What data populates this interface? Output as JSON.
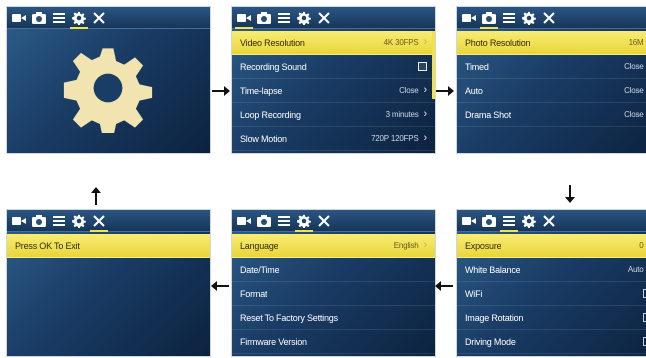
{
  "screens": {
    "s1": {
      "tabs": [
        "video-icon",
        "camera-icon",
        "menu-icon",
        "gear-icon",
        "close-icon"
      ],
      "active_tab": "gear-icon"
    },
    "s2": {
      "rows": [
        {
          "label": "Video Resolution",
          "value": "4K 30FPS",
          "control": "chevron",
          "selected": true
        },
        {
          "label": "Recording Sound",
          "value": "",
          "control": "checkbox-checked",
          "selected": false
        },
        {
          "label": "Time-lapse",
          "value": "Close",
          "control": "chevron",
          "selected": false
        },
        {
          "label": "Loop Recording",
          "value": "3 minutes",
          "control": "chevron",
          "selected": false
        },
        {
          "label": "Slow Motion",
          "value": "720P 120FPS",
          "control": "chevron",
          "selected": false
        }
      ]
    },
    "s3": {
      "rows": [
        {
          "label": "Photo Resolution",
          "value": "16M",
          "control": "chevron",
          "selected": true
        },
        {
          "label": "Timed",
          "value": "Close",
          "control": "chevron",
          "selected": false
        },
        {
          "label": "Auto",
          "value": "Close",
          "control": "chevron",
          "selected": false
        },
        {
          "label": "Drama Shot",
          "value": "Close",
          "control": "chevron",
          "selected": false
        }
      ]
    },
    "s4": {
      "rows": [
        {
          "label": "Press OK To Exit",
          "value": "",
          "control": "none",
          "selected": true
        }
      ]
    },
    "s5": {
      "rows": [
        {
          "label": "Language",
          "value": "English",
          "control": "chevron",
          "selected": true
        },
        {
          "label": "Date/Time",
          "value": "",
          "control": "none",
          "selected": false
        },
        {
          "label": "Format",
          "value": "",
          "control": "none",
          "selected": false
        },
        {
          "label": "Reset To Factory Settings",
          "value": "",
          "control": "none",
          "selected": false
        },
        {
          "label": "Firmware Version",
          "value": "",
          "control": "none",
          "selected": false
        }
      ]
    },
    "s6": {
      "rows": [
        {
          "label": "Exposure",
          "value": "0",
          "control": "chevron",
          "selected": true
        },
        {
          "label": "White Balance",
          "value": "Auto",
          "control": "chevron",
          "selected": false
        },
        {
          "label": "WiFi",
          "value": "",
          "control": "checkbox",
          "selected": false
        },
        {
          "label": "Image Rotation",
          "value": "",
          "control": "checkbox",
          "selected": false
        },
        {
          "label": "Driving Mode",
          "value": "",
          "control": "checkbox",
          "selected": false
        }
      ]
    }
  },
  "colors": {
    "highlight": "#f3e14a",
    "screen_bg": "#1a3d66",
    "text": "#ffffff"
  }
}
